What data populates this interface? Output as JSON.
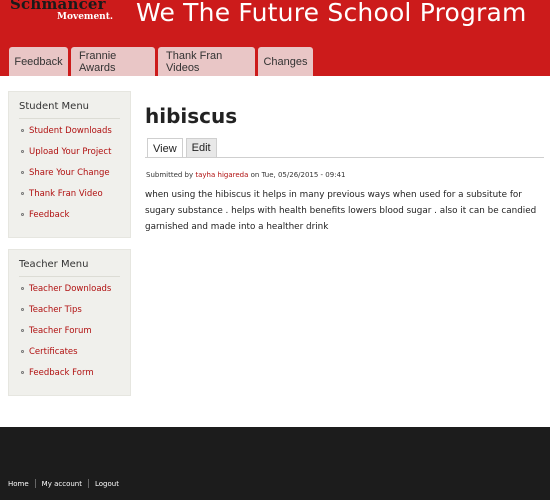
{
  "header": {
    "logo_top": "Schmancer",
    "logo_bottom": "Movement.",
    "site_title": "We The Future School Program"
  },
  "nav": {
    "tabs": [
      {
        "label": "Feedback"
      },
      {
        "label": "Frannie Awards"
      },
      {
        "label": "Thank Fran Videos"
      },
      {
        "label": "Changes"
      }
    ]
  },
  "sidebar": {
    "student_menu": {
      "title": "Student Menu",
      "items": [
        {
          "label": "Student Downloads"
        },
        {
          "label": "Upload Your Project"
        },
        {
          "label": "Share Your Change"
        },
        {
          "label": "Thank Fran Video"
        },
        {
          "label": "Feedback"
        }
      ]
    },
    "teacher_menu": {
      "title": "Teacher Menu",
      "items": [
        {
          "label": "Teacher Downloads"
        },
        {
          "label": "Teacher Tips"
        },
        {
          "label": "Teacher Forum"
        },
        {
          "label": "Certificates"
        },
        {
          "label": "Feedback Form"
        }
      ]
    }
  },
  "main": {
    "title": "hibiscus",
    "local_tabs": [
      {
        "label": "View"
      },
      {
        "label": "Edit"
      }
    ],
    "submitted_prefix": "Submitted by",
    "author": "tayha higareda",
    "submitted_date": "on Tue, 05/26/2015 - 09:41",
    "body": "when using the hibiscus it helps in many previous ways when used for a subsitute  for sugary substance . helps with health benefits lowers blood sugar . also it can be candied garnished and made into a healther drink"
  },
  "footer": {
    "links": [
      {
        "label": "Home"
      },
      {
        "label": "My account"
      },
      {
        "label": "Logout"
      }
    ]
  },
  "colors": {
    "header_red": "#cc1b1b",
    "tab_pink": "#e9c6c6",
    "link_red": "#b01010",
    "footer_dark": "#1c1c1c",
    "sidebar_bg": "#f0f0ec"
  }
}
